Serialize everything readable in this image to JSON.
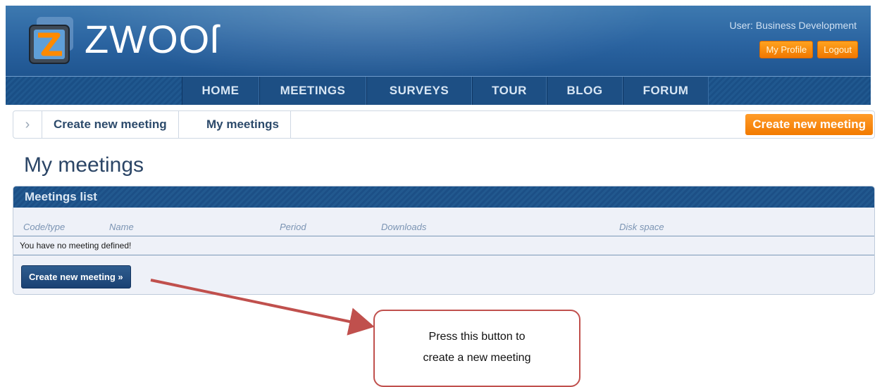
{
  "header": {
    "logo_text": "ZWOOſ",
    "user_label": "User: Business Development",
    "my_profile": "My Profile",
    "logout": "Logout",
    "icon": "zwoor-logo-icon"
  },
  "nav": {
    "items": [
      {
        "label": "HOME"
      },
      {
        "label": "MEETINGS"
      },
      {
        "label": "SURVEYS"
      },
      {
        "label": "TOUR"
      },
      {
        "label": "BLOG"
      },
      {
        "label": "FORUM"
      }
    ]
  },
  "breadcrumb": {
    "arrow": "chevron-right-icon",
    "items": [
      "Create new meeting",
      "My meetings"
    ],
    "action_button": "Create new meeting"
  },
  "page_title": "My meetings",
  "panel": {
    "title": "Meetings list",
    "columns": [
      "Code/type",
      "Name",
      "Period",
      "Downloads",
      "Disk space"
    ],
    "empty_message": "You have no meeting defined!",
    "button_label": "Create new meeting »"
  },
  "callout": {
    "line1": "Press this button to",
    "line2": "create a new meeting"
  },
  "colors": {
    "header_blue": "#2a63a0",
    "nav_blue": "#1d4f84",
    "orange": "#f27a00",
    "callout_red": "#c0504d"
  }
}
